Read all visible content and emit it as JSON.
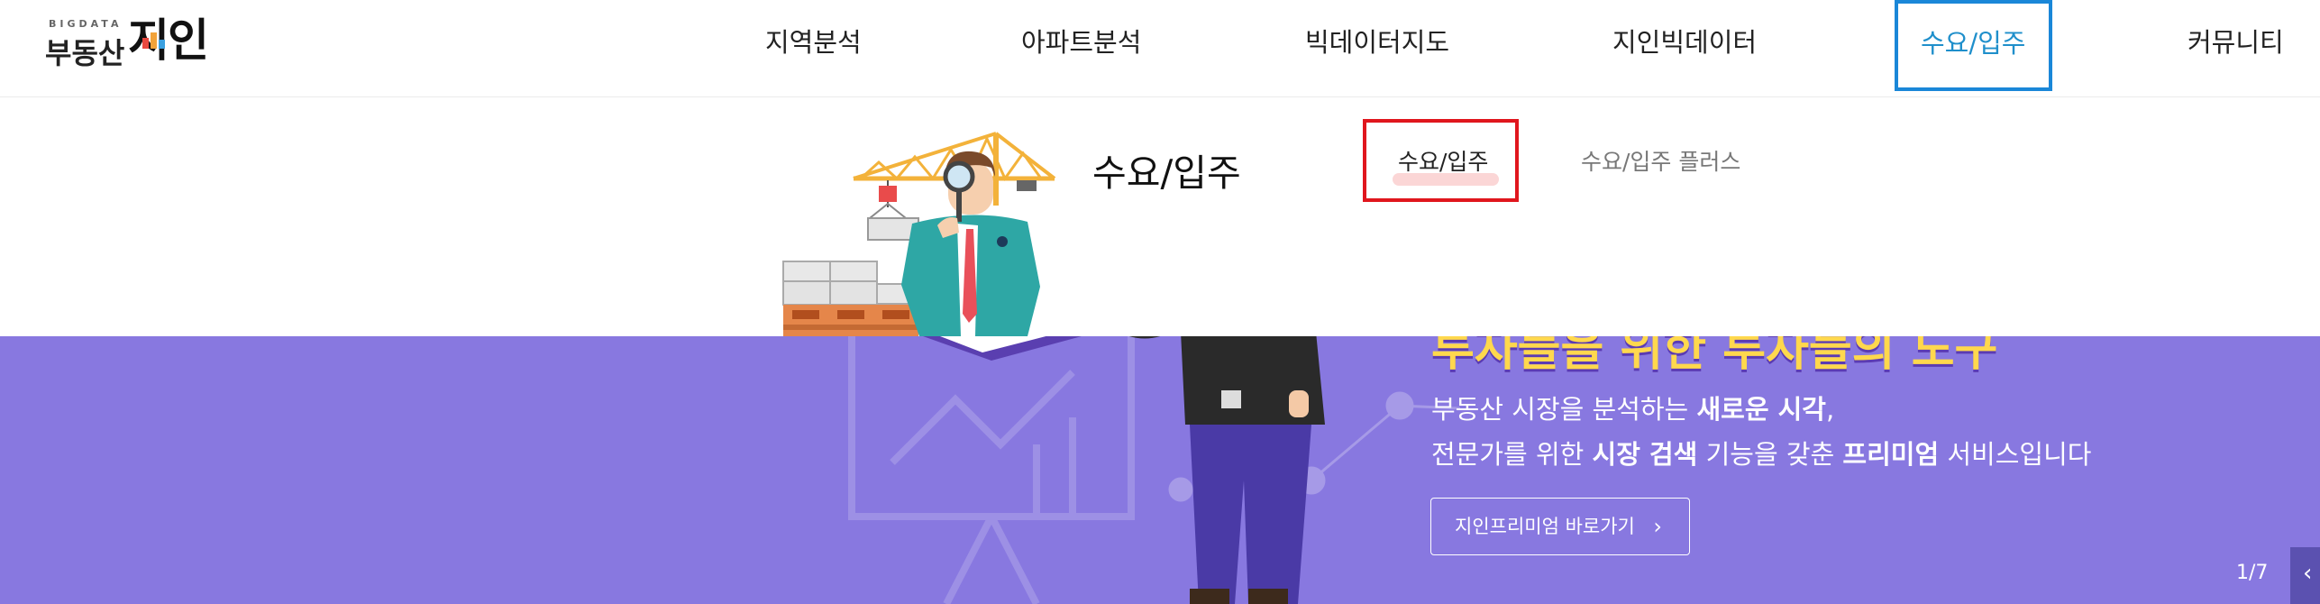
{
  "brand": {
    "tagline": "BIGDATA",
    "name_left": "부동산",
    "name_right": "지인"
  },
  "nav": {
    "items": [
      {
        "label": "지역분석"
      },
      {
        "label": "아파트분석"
      },
      {
        "label": "빅데이터지도"
      },
      {
        "label": "지인빅데이터"
      },
      {
        "label": "수요/입주",
        "active": true
      },
      {
        "label": "커뮤니티"
      }
    ]
  },
  "submenu": {
    "title": "수요/입주",
    "links": [
      {
        "label": "수요/입주",
        "active": true
      },
      {
        "label": "수요/입주 플러스"
      }
    ]
  },
  "hero": {
    "headline": "투자들을 위한 투자들의 도구",
    "desc_line1": {
      "text1": "부동산 시장을 분석하는 ",
      "bold1": "새로운 시각",
      "text2": ","
    },
    "desc_line2": {
      "text1": "전문가를 위한 ",
      "bold1": "시장 검색",
      "text2": " 기능을 갖춘 ",
      "bold2": "프리미엄",
      "text3": " 서비스입니다"
    },
    "button_label": "지인프리미엄 바로가기",
    "pager": "1/7",
    "background": "#8878e0"
  },
  "colors": {
    "accent_blue": "#1a87d8",
    "highlight_red": "#e0161d",
    "hero_purple": "#8878e0"
  },
  "icons": {
    "button_chevron": "chevron-right-icon",
    "side_tab": "chevron-left-icon"
  }
}
